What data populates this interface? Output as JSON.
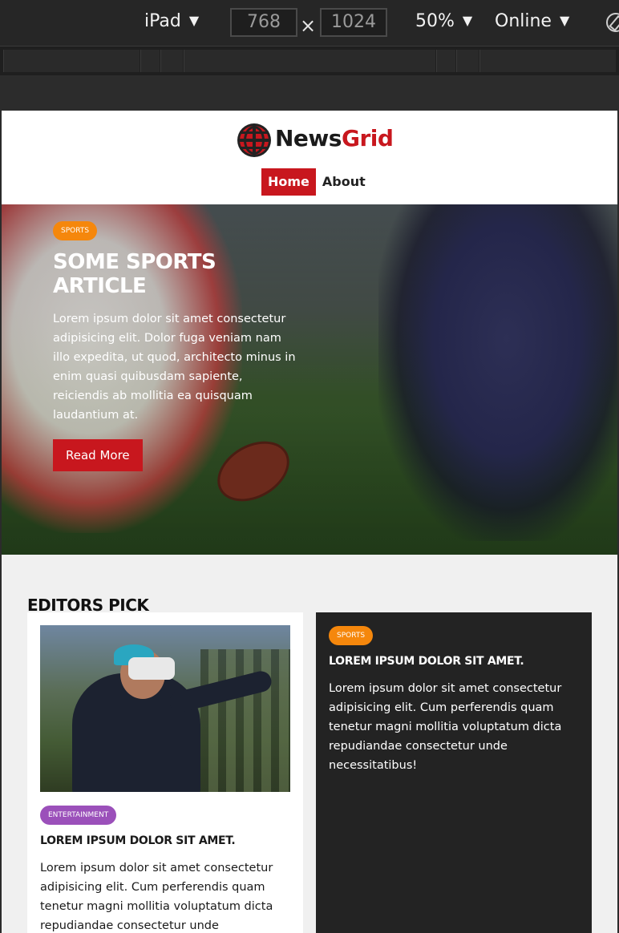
{
  "devtools": {
    "device": "iPad",
    "width": "768",
    "height": "1024",
    "dimension_separator": "×",
    "zoom": "50%",
    "network": "Online",
    "caret": "▼"
  },
  "site": {
    "logo": {
      "news": "News",
      "grid": "Grid"
    },
    "nav": [
      {
        "label": "Home",
        "active": true
      },
      {
        "label": "About",
        "active": false
      }
    ],
    "hero": {
      "badge": "SPORTS",
      "title": "Some Sports Article",
      "text": "Lorem ipsum dolor sit amet consectetur adipisicing elit. Dolor fuga veniam nam illo expedita, ut quod, architecto minus in enim quasi quibusdam sapiente, reiciendis ab mollitia ea quisquam laudantium at.",
      "button": "Read More"
    },
    "editors_pick": {
      "title": "Editors Pick",
      "cards": [
        {
          "badge": "ENTERTAINMENT",
          "title": "Lorem ipsum dolor sit amet.",
          "text": "Lorem ipsum dolor sit amet consectetur adipisicing elit. Cum perferendis quam tenetur magni mollitia voluptatum dicta repudiandae consectetur unde"
        },
        {
          "badge": "SPORTS",
          "title": "Lorem ipsum dolor sit amet.",
          "text": "Lorem ipsum dolor sit amet consectetur adipisicing elit. Cum perferendis quam tenetur magni mollitia voluptatum dicta repudiandae consectetur unde necessitatibus!"
        }
      ]
    }
  },
  "colors": {
    "brand_red": "#c8171e",
    "sports_orange": "#f5870c",
    "entertainment_purple": "#9b50ba",
    "dark_card": "#232323"
  },
  "icons": [
    "globe-icon",
    "rotate-icon",
    "caret-down-icon"
  ]
}
